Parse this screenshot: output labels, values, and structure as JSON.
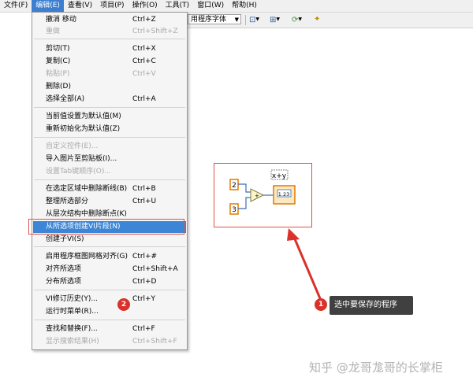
{
  "menubar": [
    "文件(F)",
    "编辑(E)",
    "查看(V)",
    "项目(P)",
    "操作(O)",
    "工具(T)",
    "窗口(W)",
    "帮助(H)"
  ],
  "toolbar": {
    "font_label": "用程序字体"
  },
  "edit_menu": [
    {
      "label": "撤消 移动",
      "key": "Ctrl+Z",
      "disabled": false
    },
    {
      "label": "重做",
      "key": "Ctrl+Shift+Z",
      "disabled": true
    },
    {
      "label": "剪切(T)",
      "key": "Ctrl+X",
      "disabled": false
    },
    {
      "label": "复制(C)",
      "key": "Ctrl+C",
      "disabled": false
    },
    {
      "label": "粘贴(P)",
      "key": "Ctrl+V",
      "disabled": true
    },
    {
      "label": "删除(D)",
      "key": "",
      "disabled": false
    },
    {
      "label": "选择全部(A)",
      "key": "Ctrl+A",
      "disabled": false
    },
    {
      "label": "当前值设置为默认值(M)",
      "key": "",
      "disabled": false
    },
    {
      "label": "重新初始化为默认值(Z)",
      "key": "",
      "disabled": false
    },
    {
      "label": "自定义控件(E)...",
      "key": "",
      "disabled": true
    },
    {
      "label": "导入图片至剪贴板(I)...",
      "key": "",
      "disabled": false
    },
    {
      "label": "设置Tab键顺序(O)...",
      "key": "",
      "disabled": true
    },
    {
      "label": "在选定区域中删除断线(B)",
      "key": "Ctrl+B",
      "disabled": false
    },
    {
      "label": "整理所选部分",
      "key": "Ctrl+U",
      "disabled": false
    },
    {
      "label": "从层次结构中删除断点(K)",
      "key": "",
      "disabled": false
    },
    {
      "label": "从所选项创建VI片段(N)",
      "key": "",
      "disabled": false,
      "highlighted": true
    },
    {
      "label": "创建子VI(S)",
      "key": "",
      "disabled": false
    },
    {
      "label": "启用程序框图网格对齐(G)",
      "key": "Ctrl+#",
      "disabled": false
    },
    {
      "label": "对齐所选项",
      "key": "Ctrl+Shift+A",
      "disabled": false
    },
    {
      "label": "分布所选项",
      "key": "Ctrl+D",
      "disabled": false
    },
    {
      "label": "VI修订历史(Y)...",
      "key": "Ctrl+Y",
      "disabled": false
    },
    {
      "label": "运行时菜单(R)...",
      "key": "",
      "disabled": false
    },
    {
      "label": "查找和替换(F)...",
      "key": "Ctrl+F",
      "disabled": false
    },
    {
      "label": "显示搜索结果(H)",
      "key": "Ctrl+Shift+F",
      "disabled": true
    }
  ],
  "diagram": {
    "const_a": "2",
    "const_b": "3",
    "label": "x+y",
    "indicator": "1.23"
  },
  "callouts": {
    "one": "1",
    "two": "2",
    "tip_text": "选中要保存的程序"
  },
  "watermark": "知乎 @龙哥尨哥的长掌柜",
  "colors": {
    "highlight": "#3d86d6",
    "callout": "#d9322b",
    "wire_orange": "#e07a00",
    "wire_blue": "#3b6fb6"
  }
}
